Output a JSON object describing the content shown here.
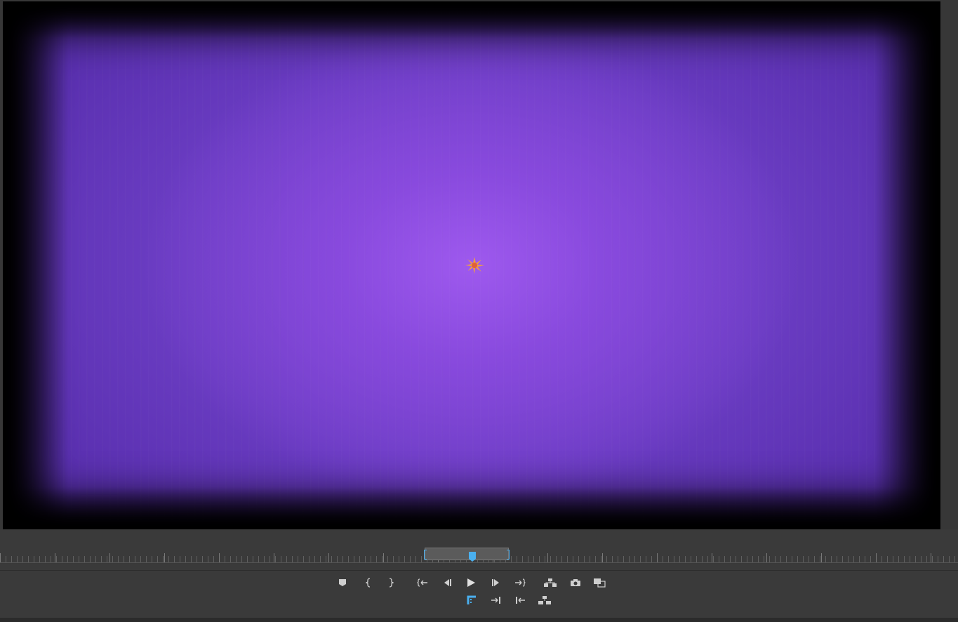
{
  "monitor": {
    "accent_color": "#4ab0f0",
    "frame_colors": {
      "center": "#a05af0",
      "mid": "#7a45cf",
      "edge": "#000000"
    }
  },
  "controls": {
    "row1": [
      {
        "icon": "add-marker-icon"
      },
      {
        "icon": "mark-in-icon"
      },
      {
        "icon": "mark-out-icon"
      },
      {
        "icon": "go-to-in-icon"
      },
      {
        "icon": "step-back-icon"
      },
      {
        "icon": "play-icon"
      },
      {
        "icon": "step-forward-icon"
      },
      {
        "icon": "go-to-out-icon"
      },
      {
        "icon": "lift-icon"
      },
      {
        "icon": "export-frame-icon"
      },
      {
        "icon": "comparison-view-icon"
      }
    ],
    "row2": [
      {
        "icon": "trim-icon"
      },
      {
        "icon": "insert-icon"
      },
      {
        "icon": "overwrite-icon"
      },
      {
        "icon": "extract-icon"
      }
    ]
  }
}
